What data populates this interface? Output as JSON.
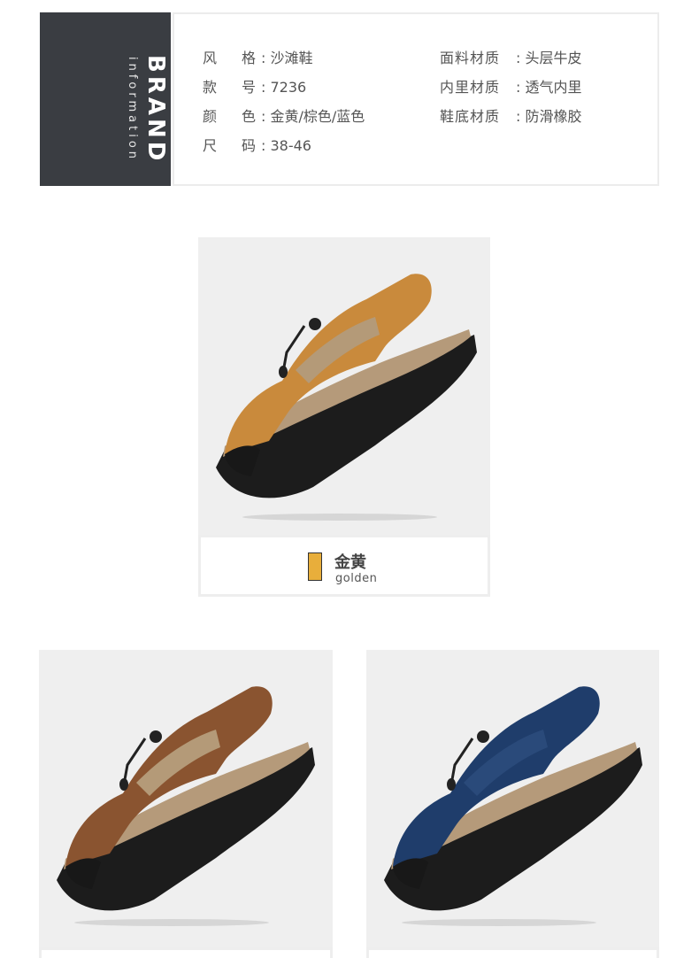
{
  "brand": {
    "title": "BRAND",
    "subtitle": "information"
  },
  "specs": {
    "left": [
      {
        "label": "风格",
        "value": "沙滩鞋"
      },
      {
        "label": "款号",
        "value": "7236"
      },
      {
        "label": "颜色",
        "value": "金黄/棕色/蓝色"
      },
      {
        "label": "尺码",
        "value": "38-46"
      }
    ],
    "right": [
      {
        "label": "面料材质",
        "value": "头层牛皮"
      },
      {
        "label": "内里材质",
        "value": "透气内里"
      },
      {
        "label": "鞋底材质",
        "value": "防滑橡胶"
      }
    ]
  },
  "products": [
    {
      "color_cn": "金黄",
      "color_en": "golden",
      "upper_color": "#c98a3c",
      "swatch_color": "#e8ae3b"
    },
    {
      "upper_color": "#8a5430"
    },
    {
      "upper_color": "#1f3d6b"
    }
  ]
}
